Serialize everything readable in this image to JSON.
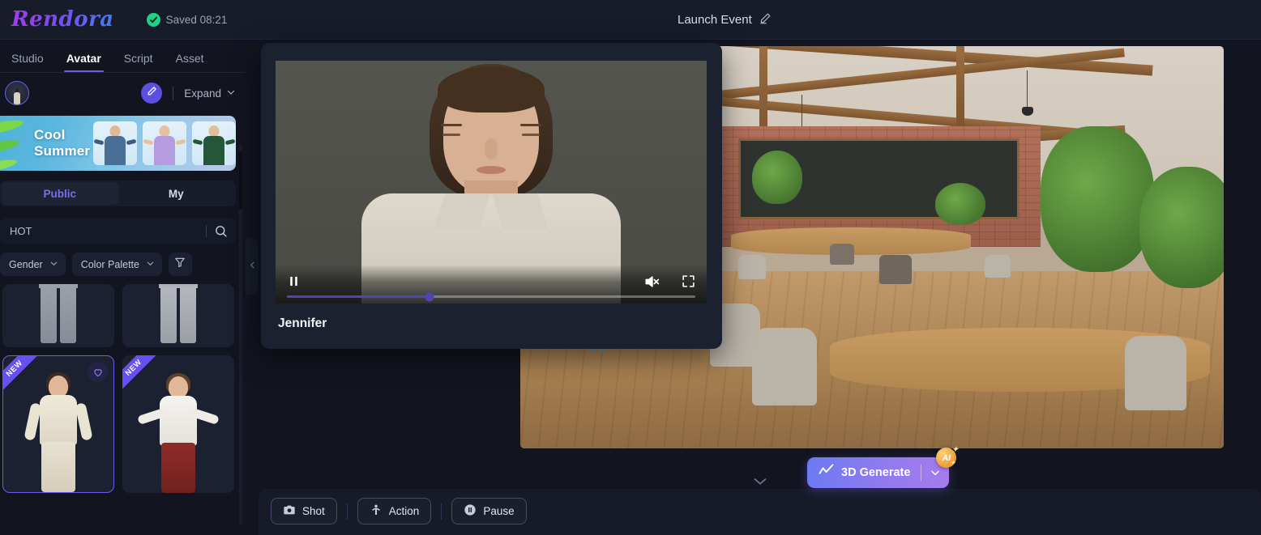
{
  "header": {
    "logo": "Rendora",
    "saved_status": "Saved 08:21",
    "project_title": "Launch Event",
    "check_icon": "check-circle-icon",
    "edit_icon": "pencil-icon"
  },
  "sidebar": {
    "nav_tabs": [
      {
        "label": "Studio",
        "active": false
      },
      {
        "label": "Avatar",
        "active": true
      },
      {
        "label": "Script",
        "active": false
      },
      {
        "label": "Asset",
        "active": false
      }
    ],
    "avatar_row": {
      "avatar_icon": "avatar-thumbnail",
      "edit_icon": "pencil-icon",
      "expand_label": "Expand",
      "expand_caret": "chevron-down-icon"
    },
    "promo": {
      "title_line1": "Cool",
      "title_line2": "Summer",
      "thumb_count": 3
    },
    "segments": [
      {
        "label": "Public",
        "active": true
      },
      {
        "label": "My",
        "active": false
      }
    ],
    "search": {
      "value": "HOT",
      "placeholder": "Search",
      "icon": "search-icon"
    },
    "filters": [
      {
        "label": "Gender",
        "icon": "chevron-down-icon"
      },
      {
        "label": "Color Palette",
        "icon": "chevron-down-icon"
      }
    ],
    "filter_button_icon": "funnel-filter-icon",
    "cards": [
      {
        "type": "clothing",
        "badge": "",
        "favorite": false,
        "selected": false,
        "name": "plaid-trousers"
      },
      {
        "type": "clothing",
        "badge": "",
        "favorite": false,
        "selected": false,
        "name": "grey-jeans"
      },
      {
        "type": "avatar",
        "badge": "NEW",
        "favorite": true,
        "selected": true,
        "name": "cream-suit-avatar"
      },
      {
        "type": "avatar",
        "badge": "NEW",
        "favorite": false,
        "selected": false,
        "name": "red-skirt-avatar"
      }
    ],
    "collapse_icon": "chevron-left-icon"
  },
  "preview": {
    "name": "Jennifer",
    "pause_icon": "pause-icon",
    "mute_icon": "volume-muted-icon",
    "fullscreen_icon": "fullscreen-icon",
    "progress_percent": 35
  },
  "stage": {
    "generate_button": {
      "label": "3D Generate",
      "icon": "trend-line-icon",
      "caret_icon": "chevron-down-icon",
      "ai_badge": "AI",
      "gradient_start": "#6b7af2",
      "gradient_end": "#a57cec"
    },
    "panel_caret_icon": "chevron-down-icon",
    "toolbar": [
      {
        "label": "Shot",
        "icon": "camera-icon"
      },
      {
        "label": "Action",
        "icon": "person-raise-arms-icon"
      },
      {
        "label": "Pause",
        "icon": "pause-circle-icon"
      }
    ]
  },
  "colors": {
    "accent_purple": "#6c5ce7",
    "bg_dark": "#12151f",
    "panel_dark": "#171b28",
    "success_green": "#1fd08a"
  }
}
